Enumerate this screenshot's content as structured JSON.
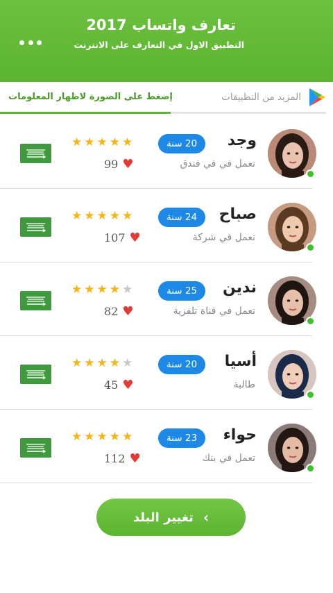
{
  "header": {
    "title": "تعارف واتساب 2017",
    "subtitle": "التطبيق الاول في التعارف على الانترنت",
    "more_icon": "more-dots-icon"
  },
  "tabs": {
    "more_apps_label": "المزيد من التطبيقات",
    "more_apps_icon": "play-store-icon",
    "tap_photo_label": "إضغط على الصورة لاظهار المعلومات",
    "active": "tap_photo"
  },
  "colors": {
    "brand_green": "#5cb431",
    "age_badge_blue": "#1d88e5",
    "star_gold": "#f5b417",
    "online_green": "#3ec22b",
    "heart_red": "#e53935"
  },
  "profiles": [
    {
      "name": "وجد",
      "job": "تعمل في في فندق",
      "age": "20 سنة",
      "rating": 5,
      "likes": "99",
      "online": true,
      "flag_icon": "saudi-flag-icon"
    },
    {
      "name": "صباح",
      "job": "تعمل في شركة",
      "age": "24 سنة",
      "rating": 5,
      "likes": "107",
      "online": true,
      "flag_icon": "saudi-flag-icon"
    },
    {
      "name": "ندين",
      "job": "تعمل في قناة تلفزية",
      "age": "25 سنة",
      "rating": 4,
      "likes": "82",
      "online": true,
      "flag_icon": "saudi-flag-icon"
    },
    {
      "name": "أسيا",
      "job": "طالبة",
      "age": "20 سنة",
      "rating": 4,
      "likes": "45",
      "online": true,
      "flag_icon": "saudi-flag-icon"
    },
    {
      "name": "حواء",
      "job": "تعمل في بنك",
      "age": "23 سنة",
      "rating": 5,
      "likes": "112",
      "online": true,
      "flag_icon": "saudi-flag-icon"
    }
  ],
  "footer": {
    "change_country_label": "تغيير البلد",
    "chevron_icon": "chevron-left-icon"
  }
}
